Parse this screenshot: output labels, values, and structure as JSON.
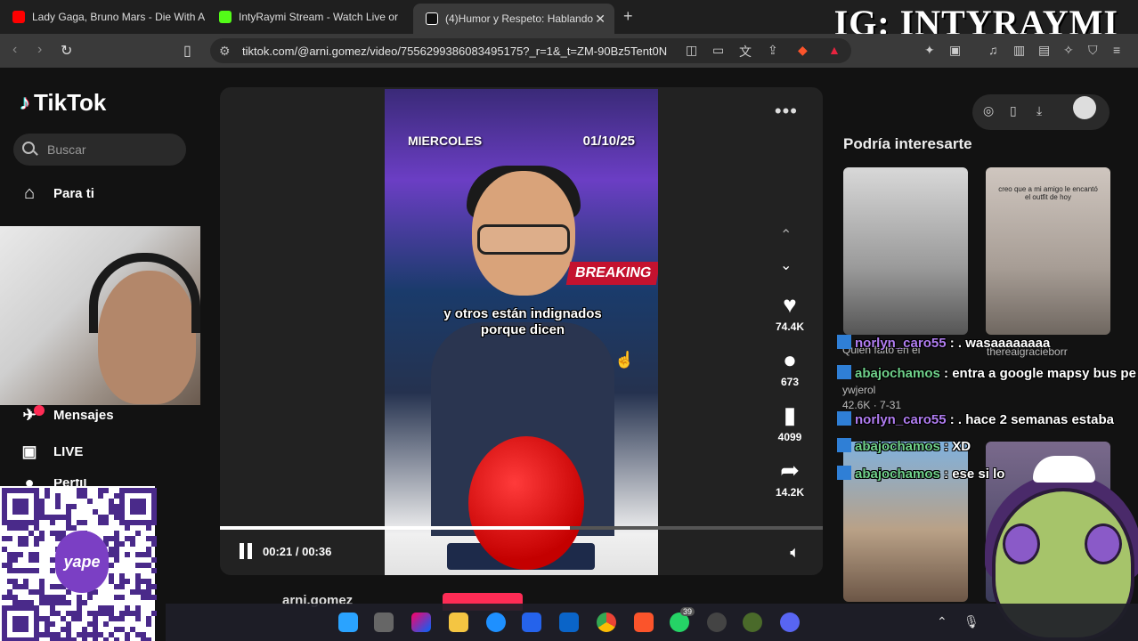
{
  "browser": {
    "tabs": [
      {
        "title": "Lady Gaga, Bruno Mars - Die With A",
        "icon_color": "#ff0000"
      },
      {
        "title": "IntyRaymi Stream - Watch Live or",
        "icon_color": "#53fc18"
      },
      {
        "title": "(4)Humor y Respeto: Hablando",
        "icon_color": "#ffffff",
        "active": true
      }
    ],
    "url": "tiktok.com/@arni.gomez/video/7556299386083495175?_r=1&_t=ZM-90Bz5Tent0N"
  },
  "overlay": {
    "ig_handle": "IG: INTYRAYMI"
  },
  "tiktok": {
    "logo_text": "TikTok",
    "search_placeholder": "Buscar",
    "nav": {
      "for_you": "Para ti",
      "messages": "Mensajes",
      "live": "LIVE",
      "profile": "Perfil"
    },
    "video": {
      "day": "MIERCOLES",
      "date": "01/10/25",
      "breaking": "BREAKING",
      "caption": "y otros están indignados porque dicen",
      "time": "00:21 / 00:36",
      "progress_fraction": 0.58
    },
    "actions": {
      "likes": "74.4K",
      "comments": "673",
      "saves": "4099",
      "shares": "14.2K"
    },
    "author": "arni.gomez",
    "recommended": {
      "title": "Podría interesarte",
      "thumb2_caption": "creo que a mi amigo le encantó el outfit de hoy",
      "meta": [
        "Quien faltó en el",
        "thereaigracieborr",
        "ywjerol",
        "42.6K · 7-31"
      ]
    }
  },
  "chat": [
    {
      "user": "norlyn_caro55",
      "message": ": . wasaaaaaaaa",
      "color": "#b07df0"
    },
    {
      "user": "abajochamos",
      "message": ": entra a google mapsy bus pe",
      "color": "#6fd08a"
    },
    {
      "user": "norlyn_caro55",
      "message": ": . hace 2 semanas estaba",
      "color": "#b07df0"
    },
    {
      "user": "abajochamos",
      "message": ": XD",
      "color": "#6fd08a"
    },
    {
      "user": "abajochamos",
      "message": ": ese si lo",
      "color": "#6fd08a"
    }
  ],
  "qr": {
    "brand": "yape"
  },
  "taskbar": {
    "whatsapp_badge": "39"
  }
}
